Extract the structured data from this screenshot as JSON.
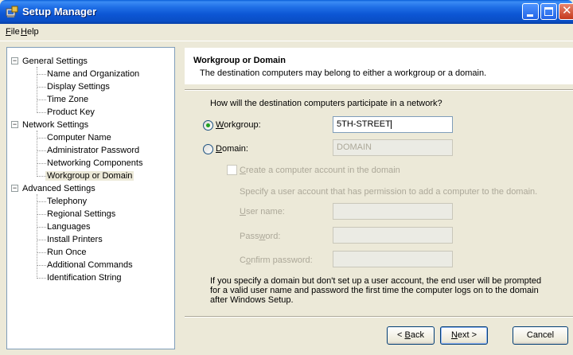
{
  "window": {
    "title": "Setup Manager"
  },
  "menu": {
    "file": "File",
    "file_key": "F",
    "file_rest": "ile",
    "help": "Help",
    "help_key": "H",
    "help_rest": "elp"
  },
  "tree": {
    "groups": [
      {
        "label": "General Settings",
        "children": [
          "Name and Organization",
          "Display Settings",
          "Time Zone",
          "Product Key"
        ]
      },
      {
        "label": "Network Settings",
        "children": [
          "Computer Name",
          "Administrator Password",
          "Networking Components",
          "Workgroup or Domain"
        ]
      },
      {
        "label": "Advanced Settings",
        "children": [
          "Telephony",
          "Regional Settings",
          "Languages",
          "Install Printers",
          "Run Once",
          "Additional Commands",
          "Identification String"
        ]
      }
    ],
    "selected": "Workgroup or Domain"
  },
  "page": {
    "title": "Workgroup or Domain",
    "description": "The destination computers may belong to either a workgroup or a domain.",
    "question": "How will the destination computers participate in a network?",
    "workgroup_label_key": "W",
    "workgroup_label_rest": "orkgroup:",
    "workgroup_value": "5TH-STREET",
    "domain_label_key": "D",
    "domain_label_rest": "omain:",
    "domain_value": "DOMAIN",
    "create_account_key": "C",
    "create_account_rest": "reate a computer account in the domain",
    "specify_text": "Specify a user account that has permission to add a computer to the domain.",
    "username_key": "U",
    "username_rest": "ser name:",
    "password_pre": "Pass",
    "password_key": "w",
    "password_rest": "ord:",
    "confirm_pre": "C",
    "confirm_key": "o",
    "confirm_rest": "nfirm password:",
    "note_line1": "If you specify a domain but don't set up a user account, the end user will be prompted",
    "note_line2": "for a valid user name and password the first time the computer logs on to the domain",
    "note_line3": "after Windows Setup."
  },
  "buttons": {
    "back_pre": "< ",
    "back_key": "B",
    "back_rest": "ack",
    "next_key": "N",
    "next_rest": "ext >",
    "cancel": "Cancel"
  },
  "state": {
    "network_mode": "workgroup"
  },
  "colors": {
    "titlebar": "#0a56d4",
    "selected_radio": "#21a121",
    "window_bg": "#ece9d8"
  }
}
